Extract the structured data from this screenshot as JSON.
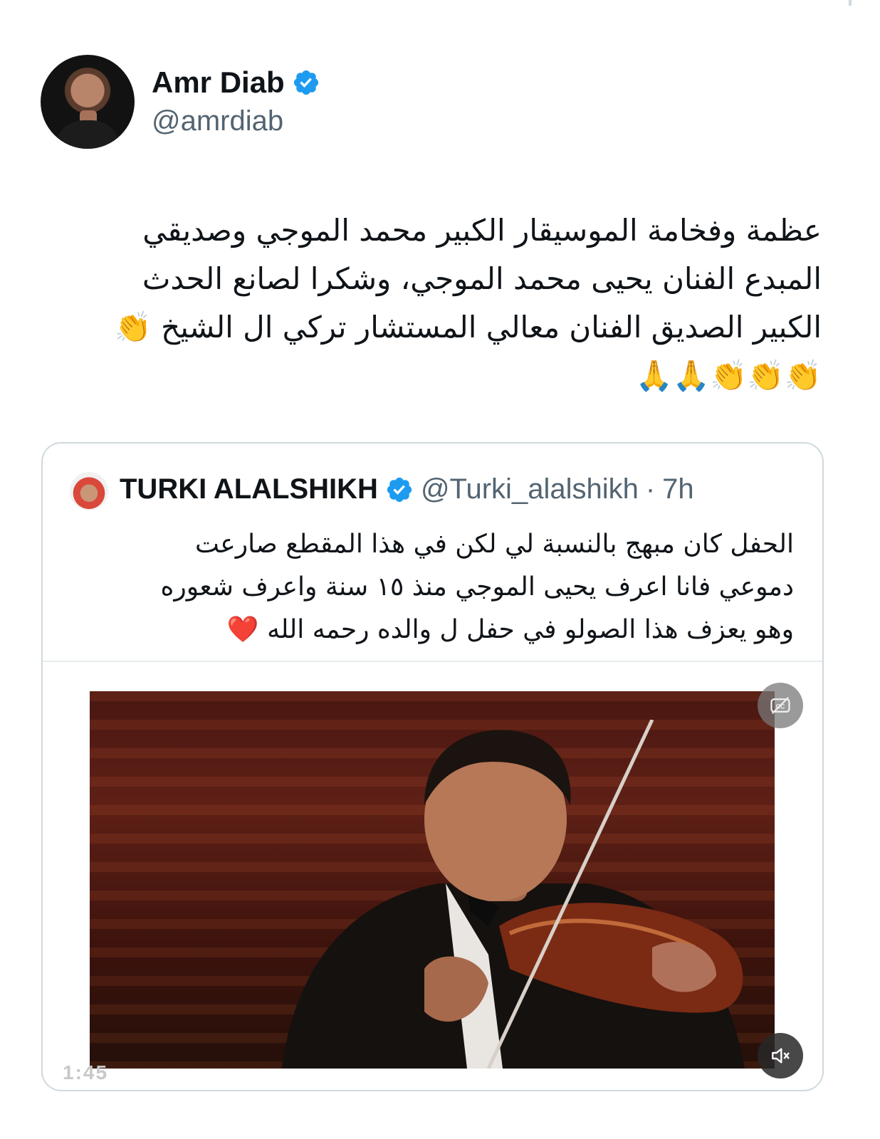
{
  "tweet": {
    "author_name": "Amr Diab",
    "author_handle": "@amrdiab",
    "verified": true,
    "text_lines": [
      "عظمة وفخامة الموسيقار الكبير محمد الموجي وصديقي",
      "المبدع الفنان يحيى محمد الموجي، وشكرا لصانع الحدث",
      "الكبير الصديق الفنان معالي المستشار تركي ال الشيخ 👏",
      "👏👏👏🙏🙏"
    ]
  },
  "quoted_tweet": {
    "author_name": "TURKI ALALSHIKH",
    "author_handle": "@Turki_alalshikh",
    "separator": "·",
    "time": "7h",
    "verified": true,
    "text_lines": [
      "الحفل كان مبهج بالنسبة لي لكن في هذا المقطع صارعت",
      "دموعي فانا اعرف يحيى الموجي منذ ١٥ سنة واعرف شعوره",
      "وهو يعزف هذا الصولو في حفل ل والده رحمه الله ❤️"
    ],
    "video": {
      "timer": "1:45",
      "cc_icon": "captions-off-icon",
      "mute_icon": "volume-muted-icon"
    }
  },
  "colors": {
    "verified_blue": "#1d9bf0",
    "secondary_text": "#536471",
    "border": "#cfd9de"
  }
}
